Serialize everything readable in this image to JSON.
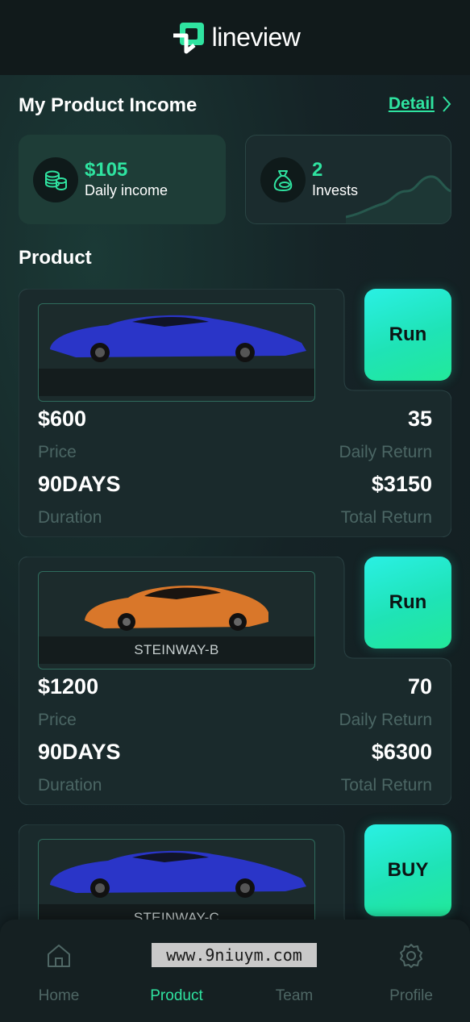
{
  "header": {
    "brand": "lineview"
  },
  "income": {
    "title": "My Product Income",
    "detail_label": "Detail",
    "daily": {
      "value": "$105",
      "label": "Daily income",
      "icon": "coins-icon"
    },
    "invests": {
      "value": "2",
      "label": "Invests",
      "icon": "money-bag-icon"
    }
  },
  "product_section": {
    "title": "Product"
  },
  "products": [
    {
      "name": "",
      "car_color": "#2a35c8",
      "action": "Run",
      "price": "$600",
      "price_label": "Price",
      "daily_return": "35",
      "daily_return_label": "Daily Return",
      "duration": "90DAYS",
      "duration_label": "Duration",
      "total_return": "$3150",
      "total_return_label": "Total Return"
    },
    {
      "name": "STEINWAY-B",
      "car_color": "#d9772a",
      "action": "Run",
      "price": "$1200",
      "price_label": "Price",
      "daily_return": "70",
      "daily_return_label": "Daily Return",
      "duration": "90DAYS",
      "duration_label": "Duration",
      "total_return": "$6300",
      "total_return_label": "Total Return"
    },
    {
      "name": "STEINWAY-C",
      "car_color": "#2a35c8",
      "action": "BUY"
    }
  ],
  "nav": {
    "items": [
      {
        "label": "Home",
        "icon": "home-icon"
      },
      {
        "label": "Product",
        "icon": "product-icon"
      },
      {
        "label": "Team",
        "icon": "team-icon"
      },
      {
        "label": "Profile",
        "icon": "gear-icon"
      }
    ],
    "active": "Product"
  },
  "watermark": "www.9niuym.com",
  "colors": {
    "accent": "#2fe3a0",
    "button_top": "#2af0e4",
    "button_bottom": "#22e99a",
    "background": "#152326"
  }
}
